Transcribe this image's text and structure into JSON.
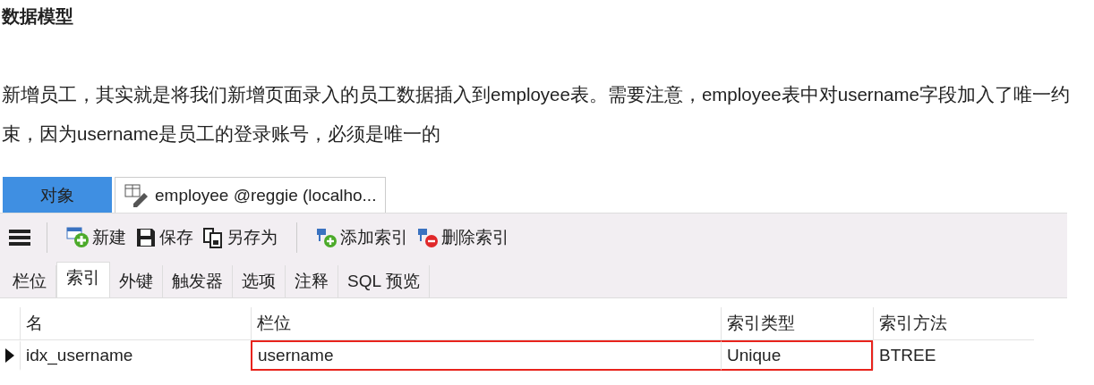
{
  "heading": "数据模型",
  "paragraph": "新增员工，其实就是将我们新增页面录入的员工数据插入到employee表。需要注意，employee表中对username字段加入了唯一约束，因为username是员工的登录账号，必须是唯一的",
  "window": {
    "tabs": [
      {
        "label": "对象",
        "selected": true,
        "kind": "plain"
      },
      {
        "label": "employee @reggie (localho...",
        "selected": false,
        "kind": "table"
      }
    ],
    "toolbar": [
      {
        "kind": "menu"
      },
      {
        "kind": "new",
        "label": "新建"
      },
      {
        "kind": "save",
        "label": "保存"
      },
      {
        "kind": "save-as",
        "label": "另存为"
      },
      {
        "kind": "add-index",
        "label": "添加索引"
      },
      {
        "kind": "delete-index",
        "label": "删除索引"
      }
    ],
    "subtabs": [
      {
        "label": "栏位",
        "selected": false
      },
      {
        "label": "索引",
        "selected": true
      },
      {
        "label": "外键",
        "selected": false
      },
      {
        "label": "触发器",
        "selected": false
      },
      {
        "label": "选项",
        "selected": false
      },
      {
        "label": "注释",
        "selected": false
      },
      {
        "label": "SQL 预览",
        "selected": false
      }
    ],
    "table": {
      "columns": [
        "名",
        "栏位",
        "索引类型",
        "索引方法"
      ],
      "rows": [
        {
          "current": true,
          "cells": [
            {
              "text": "idx_username",
              "highlighted": false
            },
            {
              "text": "username",
              "highlighted": true
            },
            {
              "text": "Unique",
              "highlighted": true
            },
            {
              "text": "BTREE",
              "highlighted": false
            }
          ]
        }
      ]
    }
  }
}
